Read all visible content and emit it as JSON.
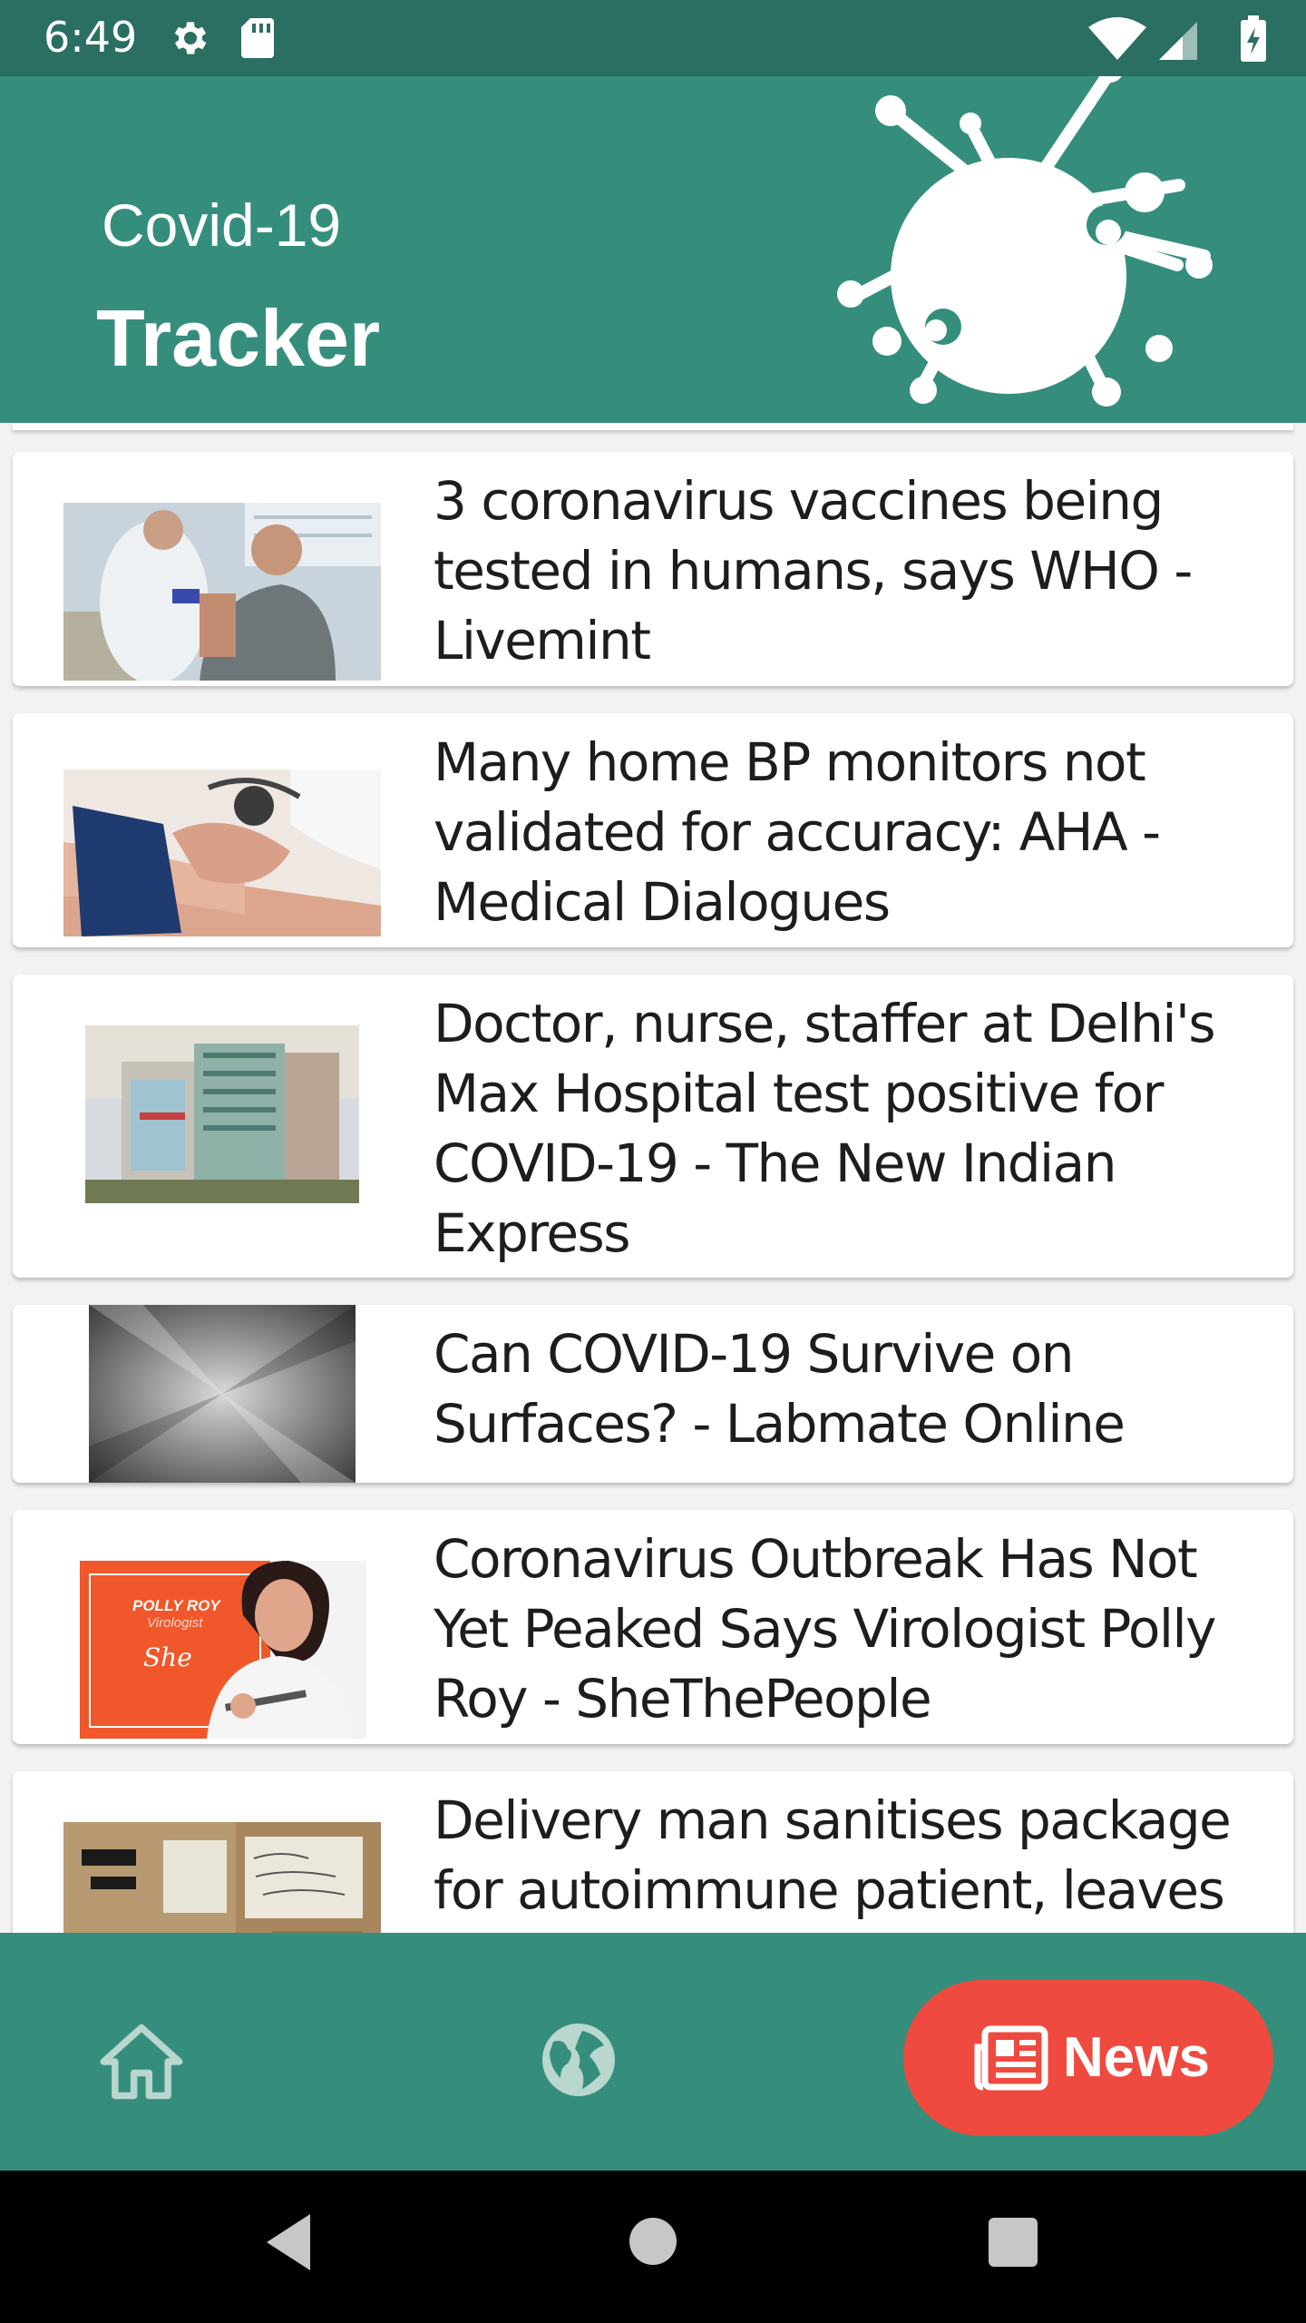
{
  "status_bar": {
    "time": "6:49"
  },
  "header": {
    "subtitle": "Covid-19",
    "title": "Tracker"
  },
  "news": [
    {
      "title": "3 coronavirus vaccines being tested in humans, says WHO - Livemint"
    },
    {
      "title": "Many home BP monitors not validated for accuracy: AHA - Medical Dialogues"
    },
    {
      "title": "Doctor, nurse, staffer at Delhi's Max Hospital test positive for COVID-19 - The New Indian Express"
    },
    {
      "title": "Can COVID-19 Survive on Surfaces? - Labmate Online"
    },
    {
      "title": "Coronavirus Outbreak Has Not Yet Peaked Says Virologist Polly Roy - SheThePeople",
      "thumb_text": {
        "line1": "POLLY ROY",
        "line2": "Virologist",
        "line3": "She"
      }
    },
    {
      "title": "Delivery man sanitises package for autoimmune patient, leaves note, Internet offers thanks"
    }
  ],
  "bottom_nav": {
    "home_icon": "home-icon",
    "world_icon": "globe-icon",
    "news_label": "News",
    "news_icon": "newspaper-icon",
    "active": "News"
  },
  "colors": {
    "status_bar": "#2b6e62",
    "header": "#358e7c",
    "accent": "#ef4a3f",
    "nav_icon_inactive": "#b9d6cf"
  }
}
